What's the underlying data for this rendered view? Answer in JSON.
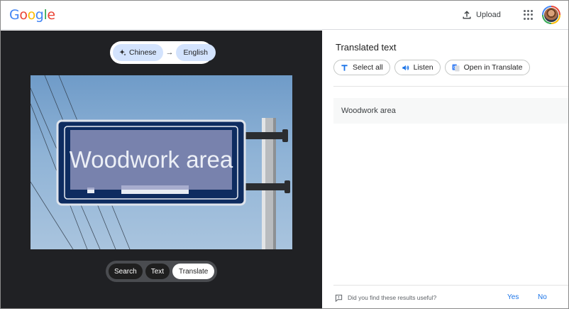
{
  "header": {
    "logo": [
      "G",
      "o",
      "o",
      "g",
      "l",
      "e"
    ],
    "logo_colors": [
      "#4285f4",
      "#ea4335",
      "#fbbc04",
      "#4285f4",
      "#34a853",
      "#ea4335"
    ],
    "upload_label": "Upload",
    "icons": {
      "upload": "upload-icon",
      "apps": "apps-grid-icon",
      "avatar": "user-avatar"
    }
  },
  "translate_bar": {
    "source_language": "Chinese",
    "target_language": "English",
    "arrow": "→",
    "source_icon": "sparkle-icon"
  },
  "image": {
    "overlay_text": "Woodwork area"
  },
  "modes": {
    "items": [
      "Search",
      "Text",
      "Translate"
    ],
    "selected": "Translate"
  },
  "panel": {
    "title": "Translated text",
    "actions": [
      {
        "label": "Select all",
        "icon": "text-t-icon"
      },
      {
        "label": "Listen",
        "icon": "speaker-icon"
      },
      {
        "label": "Open in Translate",
        "icon": "google-translate-icon"
      }
    ],
    "result_text": "Woodwork area",
    "feedback": {
      "question": "Did you find these results useful?",
      "yes": "Yes",
      "no": "No",
      "icon": "feedback-icon"
    }
  },
  "colors": {
    "accent": "#1a73e8",
    "chip_blue": "#d3e3fd",
    "left_bg": "#202124"
  }
}
